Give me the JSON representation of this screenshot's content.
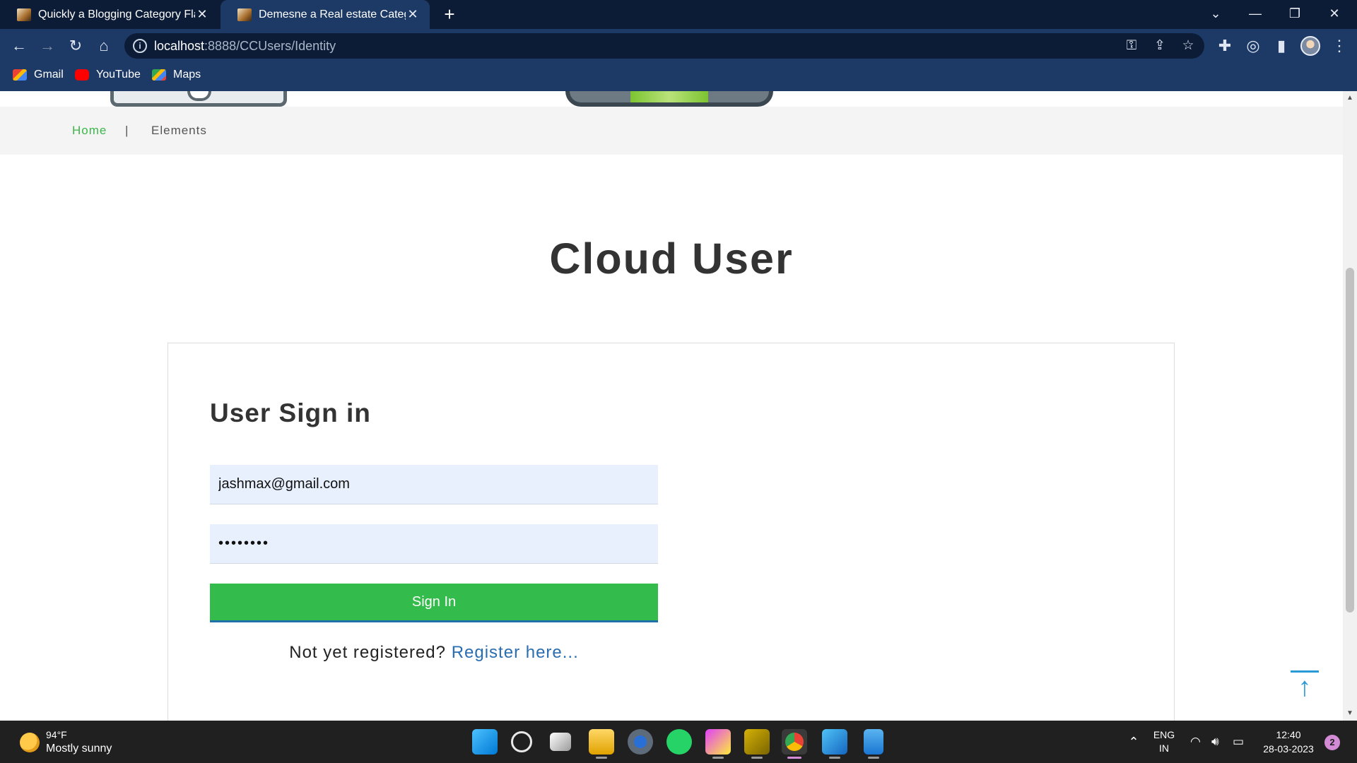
{
  "browser": {
    "tabs": [
      {
        "title": "Quickly a Blogging Category Flat",
        "active": false
      },
      {
        "title": "Demesne a Real estate Category",
        "active": true
      }
    ],
    "url_host": "localhost",
    "url_rest": ":8888/CCUsers/Identity",
    "bookmarks": [
      {
        "label": "Gmail",
        "icon": "gmail-icon"
      },
      {
        "label": "YouTube",
        "icon": "youtube-icon"
      },
      {
        "label": "Maps",
        "icon": "maps-icon"
      }
    ]
  },
  "nav": {
    "home": "Home",
    "separator": "|",
    "elements": "Elements"
  },
  "page": {
    "title": "Cloud User"
  },
  "signin": {
    "heading": "User Sign in",
    "email_value": "jashmax@gmail.com",
    "password_value": "••••••••",
    "button_label": "Sign In",
    "register_prompt": "Not yet registered?",
    "register_link": "Register here..."
  },
  "taskbar": {
    "temperature": "94°F",
    "weather": "Mostly sunny",
    "lang_top": "ENG",
    "lang_bottom": "IN",
    "time": "12:40",
    "date": "28-03-2023",
    "notifications": "2"
  },
  "colors": {
    "accent_green": "#33bb4b",
    "link_blue": "#2a6db0",
    "chrome_dark": "#0c1c36",
    "chrome_mid": "#1d3a66"
  }
}
